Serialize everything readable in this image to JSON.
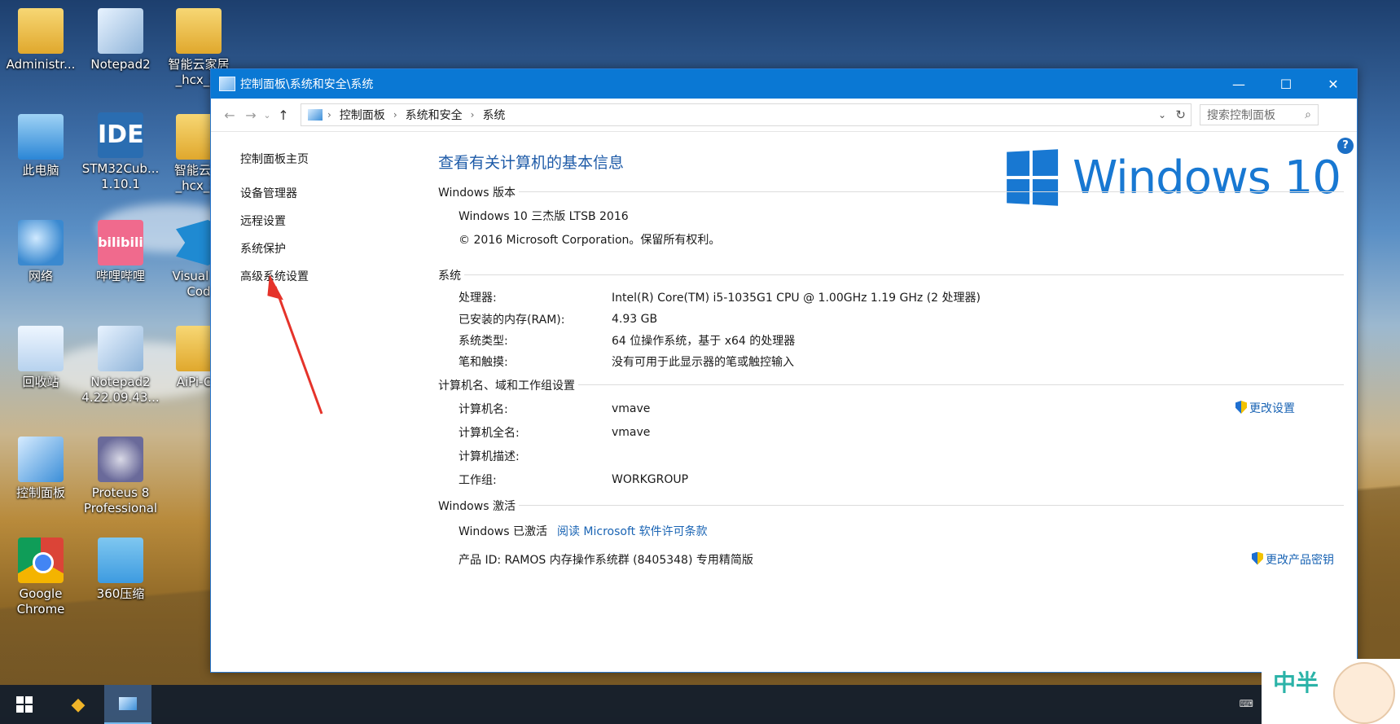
{
  "desktop": {
    "icons": [
      {
        "label": "Administr..."
      },
      {
        "label": "Notepad2"
      },
      {
        "label": "智能云家居\n_hcx_流"
      },
      {
        "label": "此电脑"
      },
      {
        "label": "STM32Cub...\n1.10.1"
      },
      {
        "label": "智能云家\n_hcx_流"
      },
      {
        "label": "网络"
      },
      {
        "label": "哔哩哔哩"
      },
      {
        "label": "Visual St\nCod"
      },
      {
        "label": "回收站"
      },
      {
        "label": "Notepad2\n4.22.09.43..."
      },
      {
        "label": "AiPi-Op"
      },
      {
        "label": "控制面板"
      },
      {
        "label": "Proteus 8\nProfessional"
      },
      {
        "label": "Google\nChrome"
      },
      {
        "label": "360压缩"
      }
    ],
    "ide_text": "IDE",
    "bili_text": "bilibili"
  },
  "window": {
    "title": "控制面板\\系统和安全\\系统",
    "minimize": "—",
    "maximize": "☐",
    "close": "✕",
    "breadcrumb": [
      "控制面板",
      "系统和安全",
      "系统"
    ],
    "search_placeholder": "搜索控制面板",
    "help": "?"
  },
  "leftnav": {
    "home": "控制面板主页",
    "items": [
      "设备管理器",
      "远程设置",
      "系统保护",
      "高级系统设置"
    ]
  },
  "main": {
    "heading": "查看有关计算机的基本信息",
    "edition": {
      "title": "Windows 版本",
      "name": "Windows 10 三杰版 LTSB 2016",
      "copyright": "© 2016 Microsoft Corporation。保留所有权利。"
    },
    "logo_text": "Windows 10",
    "system": {
      "title": "系统",
      "rows": [
        {
          "k": "处理器:",
          "v": "Intel(R) Core(TM) i5-1035G1 CPU @ 1.00GHz   1.19 GHz  (2 处理器)"
        },
        {
          "k": "已安装的内存(RAM):",
          "v": "4.93 GB"
        },
        {
          "k": "系统类型:",
          "v": "64 位操作系统，基于 x64 的处理器"
        },
        {
          "k": "笔和触摸:",
          "v": "没有可用于此显示器的笔或触控输入"
        }
      ]
    },
    "computer": {
      "title": "计算机名、域和工作组设置",
      "change": "更改设置",
      "rows": [
        {
          "k": "计算机名:",
          "v": "vmave"
        },
        {
          "k": "计算机全名:",
          "v": "vmave"
        },
        {
          "k": "计算机描述:",
          "v": ""
        },
        {
          "k": "工作组:",
          "v": "WORKGROUP"
        }
      ]
    },
    "activation": {
      "title": "Windows 激活",
      "status": "Windows 已激活",
      "license_link": "阅读 Microsoft 软件许可条款",
      "product_id": "产品 ID: RAMOS 内存操作系统群 (8405348) 专用精简版",
      "change_key": "更改产品密钥"
    }
  },
  "sticker_text": "中半"
}
